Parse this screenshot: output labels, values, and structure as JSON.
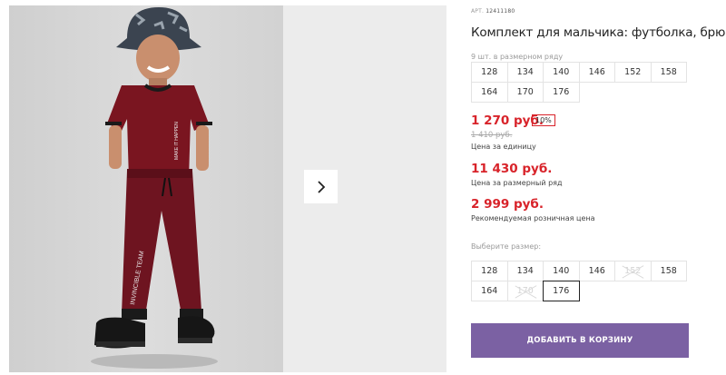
{
  "product": {
    "article_label": "АРТ.",
    "article_value": "12411180",
    "title": "Комплект для мальчика: футболка, брюки"
  },
  "gallery": {
    "next_icon": "chevron-right-icon",
    "print_text": "INVINCIBLE TEAM",
    "shirt_text": "MAKE IT HAPPEN"
  },
  "size_range": {
    "caption": "9 шт. в размерном ряду",
    "sizes": [
      "128",
      "134",
      "140",
      "146",
      "152",
      "158",
      "164",
      "170",
      "176"
    ]
  },
  "prices": {
    "unit_price": "1 270 руб.",
    "discount": "10%",
    "old_price": "1 410 руб.",
    "unit_label": "Цена за единицу",
    "range_price": "11 430 руб.",
    "range_label": "Цена за размерный ряд",
    "retail_price": "2 999 руб.",
    "retail_label": "Рекомендуемая розничная цена"
  },
  "size_select": {
    "caption": "Выберите размер:",
    "sizes": [
      {
        "label": "128",
        "available": true,
        "selected": false
      },
      {
        "label": "134",
        "available": true,
        "selected": false
      },
      {
        "label": "140",
        "available": true,
        "selected": false
      },
      {
        "label": "146",
        "available": true,
        "selected": false
      },
      {
        "label": "152",
        "available": false,
        "selected": false
      },
      {
        "label": "158",
        "available": true,
        "selected": false
      },
      {
        "label": "164",
        "available": true,
        "selected": false
      },
      {
        "label": "170",
        "available": false,
        "selected": false
      },
      {
        "label": "176",
        "available": true,
        "selected": true
      }
    ]
  },
  "cart": {
    "add_label": "ДОБАВИТЬ В КОРЗИНУ"
  },
  "colors": {
    "price_red": "#d8232a",
    "button_purple": "#7b61a3",
    "garment": "#7a1520"
  }
}
